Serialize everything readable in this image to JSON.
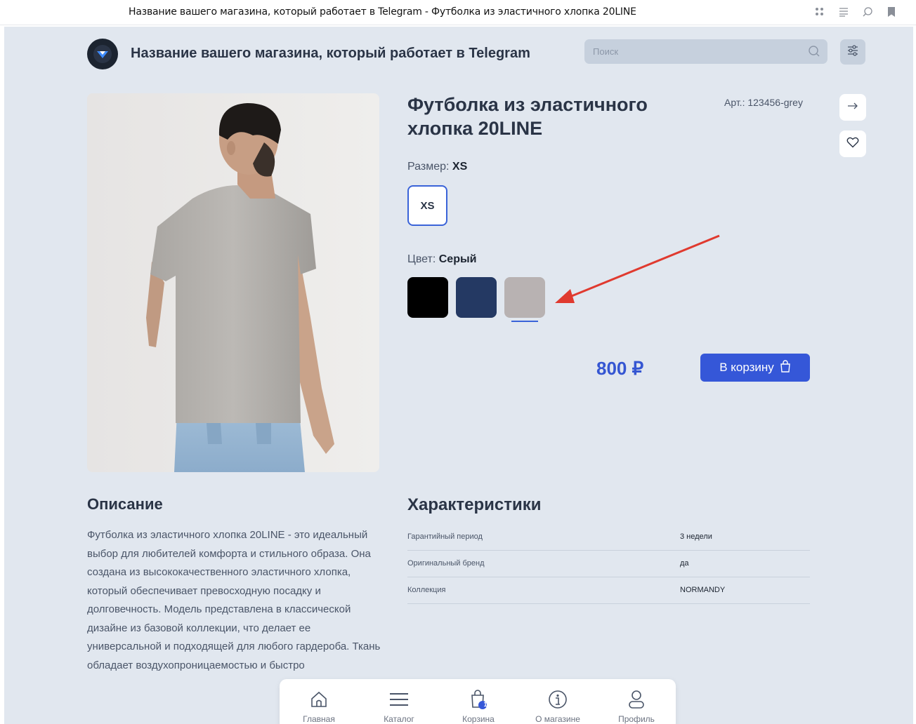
{
  "browser": {
    "tab_title": "Название вашего магазина, который работает в Telegram - Футболка из эластичного хлопка 20LINE"
  },
  "header": {
    "shop_name": "Название вашего магазина, который работает в Telegram",
    "search_placeholder": "Поиск"
  },
  "product": {
    "title": "Футболка из эластичного хлопка 20LINE",
    "sku": "Арт.: 123456-grey",
    "size_label": "Размер:",
    "size_value": "XS",
    "sizes": [
      "XS"
    ],
    "color_label": "Цвет:",
    "color_value": "Серый",
    "colors": [
      {
        "hex": "#000000"
      },
      {
        "hex": "#243963"
      },
      {
        "hex": "#b8b2b2",
        "selected": true
      }
    ],
    "price": "800 ₽",
    "cart_label": "В корзину"
  },
  "description": {
    "heading": "Описание",
    "text": "Футболка из эластичного хлопка 20LINE - это идеальный выбор для любителей комфорта и стильного образа. Она создана из высококачественного эластичного хлопка, который обеспечивает превосходную посадку и долговечность. Модель представлена в классической дизайне из базовой коллекции, что делает ее универсальной и подходящей для любого гардероба. Ткань обладает воздухопроницаемостью и быстро"
  },
  "characteristics": {
    "heading": "Характеристики",
    "rows": [
      {
        "key": "Гарантийный период",
        "value": "3 недели"
      },
      {
        "key": "Оригинальный бренд",
        "value": "да"
      },
      {
        "key": "Коллекция",
        "value": "NORMANDY"
      }
    ]
  },
  "bottom_nav": {
    "items": [
      {
        "label": "Главная",
        "icon": "home-icon"
      },
      {
        "label": "Каталог",
        "icon": "menu-icon"
      },
      {
        "label": "Корзина",
        "icon": "cart-icon",
        "badge": "1"
      },
      {
        "label": "О магазине",
        "icon": "info-icon"
      },
      {
        "label": "Профиль",
        "icon": "profile-icon"
      }
    ]
  },
  "colors": {
    "accent": "#3557d8",
    "page_background": "#e1e7ef",
    "annotation_arrow": "#e03a2f"
  }
}
